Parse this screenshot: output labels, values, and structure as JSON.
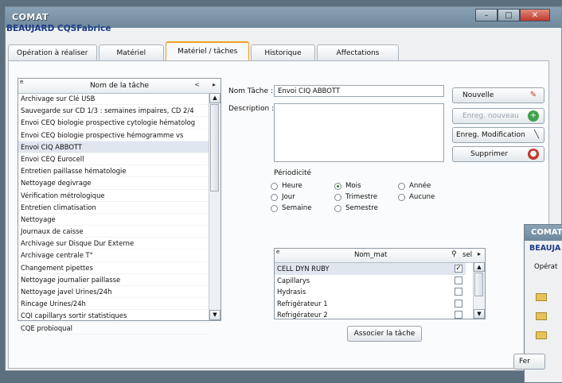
{
  "window": {
    "app_title": "COMAT",
    "subtitle": "BEAUJARD CQSFabrice",
    "controls": {
      "minimize": "–",
      "maximize": "□",
      "close": "✕"
    }
  },
  "tabs": [
    {
      "label": "Opération à réaliser",
      "active": false
    },
    {
      "label": "Matériel",
      "active": false
    },
    {
      "label": "Matériel / tâches",
      "active": true
    },
    {
      "label": "Historique",
      "active": false
    },
    {
      "label": "Affectations",
      "active": false
    }
  ],
  "task_list": {
    "header": "Nom de la tâche",
    "sort_marker": "<",
    "arrow_marker": "▸",
    "corner_marker": "e",
    "scroll_up": "▲",
    "scroll_down": "▼",
    "rows": [
      "Archivage sur Clé USB",
      "Sauvegarde sur CD 1/3 : semaines impaires, CD 2/4",
      "Envoi CEQ biologie prospective cytologie hématolog",
      "Envoi CEQ biologie prospective hémogramme vs",
      "Envoi CIQ ABBOTT",
      "Envoi CEQ Eurocell",
      "Entretien paillasse hématologie",
      "Nettoyage degivrage",
      "Vérification métrologique",
      "Entretien climatisation",
      "Nettoyage",
      "Journaux de caisse",
      "Archivage sur Disque Dur Externe",
      "Archivage centrale T°",
      "Changement pipettes",
      "Nettoyage journalier paillasse",
      "Nettoyage javel Urines/24h",
      "Rincage Urines/24h",
      "CQI capillarys sortir statistiques",
      "CQE probioqual"
    ],
    "selected_index": 4
  },
  "form": {
    "nom_tache_label": "Nom Tâche :",
    "nom_tache_value": "Envoi CIQ ABBOTT",
    "description_label": "Description :",
    "description_value": ""
  },
  "periodicite": {
    "caption": "Périodicité",
    "options": [
      "Heure",
      "Mois",
      "Année",
      "Jour",
      "Trimestre",
      "Aucune",
      "Semaine",
      "Semestre"
    ],
    "selected": "Mois"
  },
  "buttons": {
    "nouvelle": "Nouvelle",
    "enreg_nouveau": "Enreg. nouveau",
    "enreg_modification": "Enreg. Modification",
    "supprimer": "Supprimer",
    "associer": "Associer la tâche",
    "fermer": "Fer"
  },
  "materials": {
    "col_name": "Nom_mat",
    "col_sel": "sel",
    "col_arrow": "▸",
    "corner_marker": "e",
    "search_icon": "magnifier-icon",
    "scroll_up": "▲",
    "scroll_down": "▼",
    "rows": [
      {
        "name": "CELL DYN RUBY",
        "checked": true
      },
      {
        "name": "Capillarys",
        "checked": false
      },
      {
        "name": "Hydrasis",
        "checked": false
      },
      {
        "name": "Refrigérateur 1",
        "checked": false
      },
      {
        "name": "Refrigérateur 2",
        "checked": false
      }
    ]
  },
  "second_window": {
    "title": "COMAT",
    "subtitle": "BEAUJA",
    "tab_text": "Opérat"
  }
}
